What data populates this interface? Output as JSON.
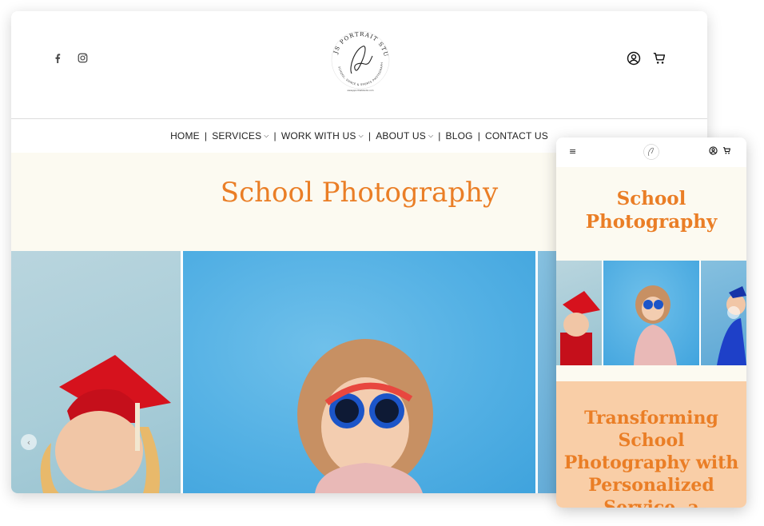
{
  "brand": {
    "name": "JS PORTRAIT STUDIO",
    "signature": "Jani",
    "tagline": "SCHOOL, DANCE & SPORTS PHOTOGRAPHY",
    "website": "www.jsportraitstudio.com"
  },
  "colors": {
    "accent": "#ea7e26",
    "hero_bg": "#fcfaf1",
    "promo_bg": "#f9cea7"
  },
  "nav": {
    "items": [
      {
        "label": "HOME",
        "dropdown": false
      },
      {
        "label": "SERVICES",
        "dropdown": true
      },
      {
        "label": "WORK WITH US",
        "dropdown": true
      },
      {
        "label": "ABOUT US",
        "dropdown": true
      },
      {
        "label": "BLOG",
        "dropdown": false
      },
      {
        "label": "CONTACT US",
        "dropdown": false
      }
    ],
    "separator": "|"
  },
  "hero": {
    "title": "School Photography"
  },
  "mobile": {
    "hero_title_line1": "School",
    "hero_title_line2": "Photography",
    "promo_lines": [
      "Transforming",
      "School",
      "Photography with",
      "Personalized",
      "Service, a"
    ]
  },
  "icons": [
    "facebook-icon",
    "instagram-icon",
    "user-icon",
    "cart-icon",
    "hamburger-icon",
    "chevron-down-icon",
    "chevron-left-icon"
  ]
}
